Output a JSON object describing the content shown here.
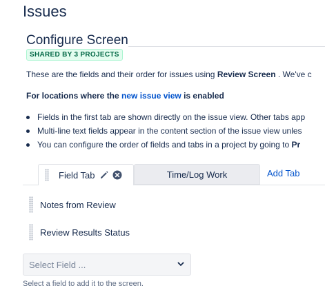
{
  "page": {
    "title": "Issues"
  },
  "screen": {
    "title": "Configure Screen",
    "badge": "SHARED BY 3 PROJECTS",
    "intro_prefix": "These are the fields and their order for issues using ",
    "intro_screen_name": "Review Screen",
    "intro_suffix": " . We've c"
  },
  "locations": {
    "heading_prefix": "For locations where the ",
    "heading_link": "new issue view",
    "heading_suffix": " is enabled",
    "bullets": [
      "Fields in the first tab are shown directly on the issue view. Other tabs app",
      "Multi-line text fields appear in the content section of the issue view unles",
      "You can configure the order of fields and tabs in a project by going to "
    ],
    "bullet3_bold": "Pr"
  },
  "tabs": {
    "items": [
      {
        "label": "Field Tab",
        "active": true
      },
      {
        "label": "Time/Log Work",
        "active": false
      }
    ],
    "add_label": "Add Tab",
    "edit_icon": "pencil-icon",
    "delete_icon": "close-circle-icon"
  },
  "fields": [
    {
      "label": "Notes from Review"
    },
    {
      "label": "Review Results Status"
    }
  ],
  "select_field": {
    "placeholder": "Select Field ...",
    "help": "Select a field to add it to the screen.",
    "icon": "chevron-down-icon"
  },
  "colors": {
    "text": "#172b4d",
    "link": "#0052cc",
    "badge_bg": "#e3fcef",
    "badge_text": "#006644",
    "inactive_tab_bg": "#ebecf0"
  }
}
